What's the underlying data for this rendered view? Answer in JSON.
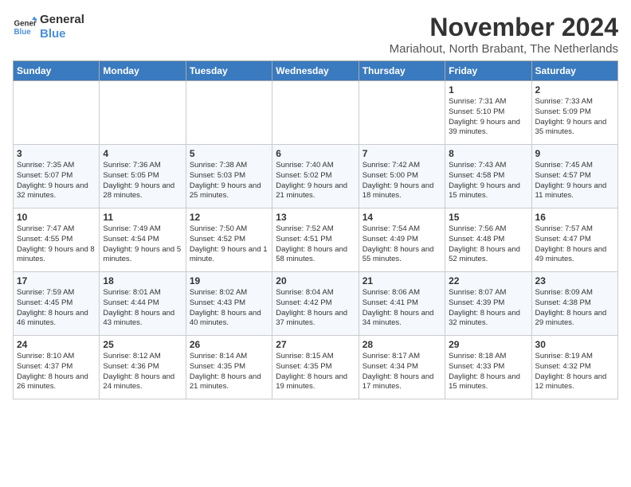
{
  "logo": {
    "line1": "General",
    "line2": "Blue"
  },
  "title": "November 2024",
  "location": "Mariahout, North Brabant, The Netherlands",
  "headers": [
    "Sunday",
    "Monday",
    "Tuesday",
    "Wednesday",
    "Thursday",
    "Friday",
    "Saturday"
  ],
  "weeks": [
    [
      {
        "day": "",
        "info": ""
      },
      {
        "day": "",
        "info": ""
      },
      {
        "day": "",
        "info": ""
      },
      {
        "day": "",
        "info": ""
      },
      {
        "day": "",
        "info": ""
      },
      {
        "day": "1",
        "info": "Sunrise: 7:31 AM\nSunset: 5:10 PM\nDaylight: 9 hours and 39 minutes."
      },
      {
        "day": "2",
        "info": "Sunrise: 7:33 AM\nSunset: 5:09 PM\nDaylight: 9 hours and 35 minutes."
      }
    ],
    [
      {
        "day": "3",
        "info": "Sunrise: 7:35 AM\nSunset: 5:07 PM\nDaylight: 9 hours and 32 minutes."
      },
      {
        "day": "4",
        "info": "Sunrise: 7:36 AM\nSunset: 5:05 PM\nDaylight: 9 hours and 28 minutes."
      },
      {
        "day": "5",
        "info": "Sunrise: 7:38 AM\nSunset: 5:03 PM\nDaylight: 9 hours and 25 minutes."
      },
      {
        "day": "6",
        "info": "Sunrise: 7:40 AM\nSunset: 5:02 PM\nDaylight: 9 hours and 21 minutes."
      },
      {
        "day": "7",
        "info": "Sunrise: 7:42 AM\nSunset: 5:00 PM\nDaylight: 9 hours and 18 minutes."
      },
      {
        "day": "8",
        "info": "Sunrise: 7:43 AM\nSunset: 4:58 PM\nDaylight: 9 hours and 15 minutes."
      },
      {
        "day": "9",
        "info": "Sunrise: 7:45 AM\nSunset: 4:57 PM\nDaylight: 9 hours and 11 minutes."
      }
    ],
    [
      {
        "day": "10",
        "info": "Sunrise: 7:47 AM\nSunset: 4:55 PM\nDaylight: 9 hours and 8 minutes."
      },
      {
        "day": "11",
        "info": "Sunrise: 7:49 AM\nSunset: 4:54 PM\nDaylight: 9 hours and 5 minutes."
      },
      {
        "day": "12",
        "info": "Sunrise: 7:50 AM\nSunset: 4:52 PM\nDaylight: 9 hours and 1 minute."
      },
      {
        "day": "13",
        "info": "Sunrise: 7:52 AM\nSunset: 4:51 PM\nDaylight: 8 hours and 58 minutes."
      },
      {
        "day": "14",
        "info": "Sunrise: 7:54 AM\nSunset: 4:49 PM\nDaylight: 8 hours and 55 minutes."
      },
      {
        "day": "15",
        "info": "Sunrise: 7:56 AM\nSunset: 4:48 PM\nDaylight: 8 hours and 52 minutes."
      },
      {
        "day": "16",
        "info": "Sunrise: 7:57 AM\nSunset: 4:47 PM\nDaylight: 8 hours and 49 minutes."
      }
    ],
    [
      {
        "day": "17",
        "info": "Sunrise: 7:59 AM\nSunset: 4:45 PM\nDaylight: 8 hours and 46 minutes."
      },
      {
        "day": "18",
        "info": "Sunrise: 8:01 AM\nSunset: 4:44 PM\nDaylight: 8 hours and 43 minutes."
      },
      {
        "day": "19",
        "info": "Sunrise: 8:02 AM\nSunset: 4:43 PM\nDaylight: 8 hours and 40 minutes."
      },
      {
        "day": "20",
        "info": "Sunrise: 8:04 AM\nSunset: 4:42 PM\nDaylight: 8 hours and 37 minutes."
      },
      {
        "day": "21",
        "info": "Sunrise: 8:06 AM\nSunset: 4:41 PM\nDaylight: 8 hours and 34 minutes."
      },
      {
        "day": "22",
        "info": "Sunrise: 8:07 AM\nSunset: 4:39 PM\nDaylight: 8 hours and 32 minutes."
      },
      {
        "day": "23",
        "info": "Sunrise: 8:09 AM\nSunset: 4:38 PM\nDaylight: 8 hours and 29 minutes."
      }
    ],
    [
      {
        "day": "24",
        "info": "Sunrise: 8:10 AM\nSunset: 4:37 PM\nDaylight: 8 hours and 26 minutes."
      },
      {
        "day": "25",
        "info": "Sunrise: 8:12 AM\nSunset: 4:36 PM\nDaylight: 8 hours and 24 minutes."
      },
      {
        "day": "26",
        "info": "Sunrise: 8:14 AM\nSunset: 4:35 PM\nDaylight: 8 hours and 21 minutes."
      },
      {
        "day": "27",
        "info": "Sunrise: 8:15 AM\nSunset: 4:35 PM\nDaylight: 8 hours and 19 minutes."
      },
      {
        "day": "28",
        "info": "Sunrise: 8:17 AM\nSunset: 4:34 PM\nDaylight: 8 hours and 17 minutes."
      },
      {
        "day": "29",
        "info": "Sunrise: 8:18 AM\nSunset: 4:33 PM\nDaylight: 8 hours and 15 minutes."
      },
      {
        "day": "30",
        "info": "Sunrise: 8:19 AM\nSunset: 4:32 PM\nDaylight: 8 hours and 12 minutes."
      }
    ]
  ]
}
